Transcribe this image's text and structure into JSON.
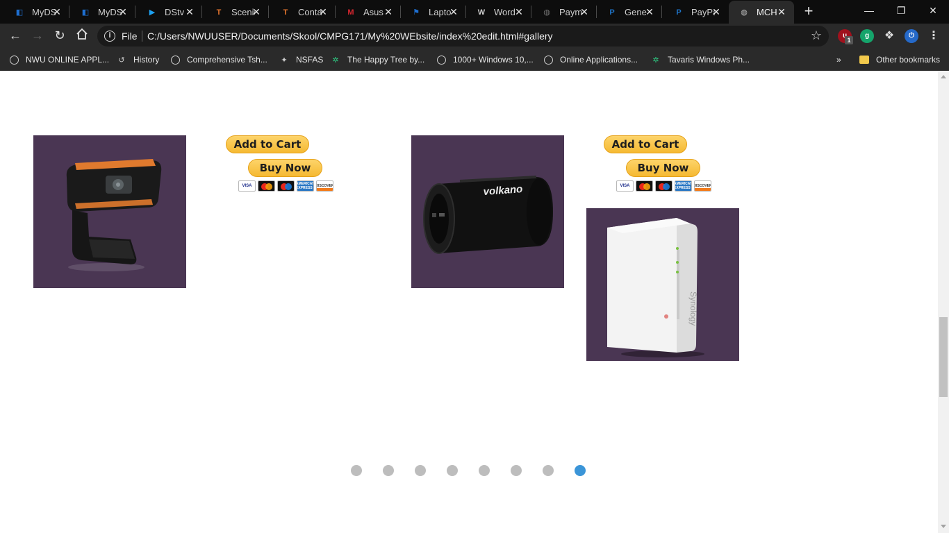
{
  "browser": {
    "tabs": [
      {
        "title": "MyDS",
        "icon": "mydsl-icon",
        "color": "#1e6fd1"
      },
      {
        "title": "MyDS",
        "icon": "mydsl-icon",
        "color": "#1e6fd1"
      },
      {
        "title": "DStv",
        "icon": "dstv-play-icon",
        "color": "#1da1f2"
      },
      {
        "title": "Scenic",
        "icon": "t-logo-icon",
        "color": "#e8772e"
      },
      {
        "title": "Conta",
        "icon": "t-logo-icon",
        "color": "#e8772e"
      },
      {
        "title": "Asus",
        "icon": "m-logo-icon",
        "color": "#d8262f"
      },
      {
        "title": "Lapto",
        "icon": "flag-icon",
        "color": "#1e6fd1"
      },
      {
        "title": "Word",
        "icon": "wordpress-icon",
        "color": "#cccccc"
      },
      {
        "title": "Paym",
        "icon": "globe-icon",
        "color": "#777777"
      },
      {
        "title": "Gene",
        "icon": "paypal-icon",
        "color": "#1f74c8"
      },
      {
        "title": "PayPa",
        "icon": "paypal-icon",
        "color": "#1f74c8"
      },
      {
        "title": "MCH",
        "icon": "globe-icon",
        "color": "#bbbbbb",
        "active": true
      }
    ],
    "new_tab": "+",
    "window": {
      "minimize": "—",
      "restore": "❐",
      "close": "✕"
    },
    "address": {
      "scheme_label": "File",
      "url": "C:/Users/NWUUSER/Documents/Skool/CMPG171/My%20WEbsite/index%20edit.html#gallery"
    },
    "extensions": [
      {
        "icon": "ublock-icon",
        "badge": "1",
        "color": "#a0111d"
      },
      {
        "icon": "grammarly-icon",
        "color": "#15a46b"
      },
      {
        "icon": "puzzle-icon",
        "color": "#2a2a2a"
      },
      {
        "icon": "power-icon",
        "color": "#2569c9"
      }
    ],
    "bookmarks": [
      {
        "label": "NWU ONLINE APPL...",
        "icon": "globe-icon"
      },
      {
        "label": "History",
        "icon": "history-icon"
      },
      {
        "label": "Comprehensive Tsh...",
        "icon": "globe-icon"
      },
      {
        "label": "NSFAS",
        "icon": "nsfas-icon"
      },
      {
        "label": "The Happy Tree by...",
        "icon": "tree-icon"
      },
      {
        "label": "1000+ Windows 10,...",
        "icon": "globe-icon"
      },
      {
        "label": "Online Applications...",
        "icon": "globe-icon"
      },
      {
        "label": "Tavaris Windows Ph...",
        "icon": "tree-icon"
      }
    ],
    "bookmarks_overflow": "»",
    "other_bookmarks": "Other bookmarks"
  },
  "gallery": {
    "products": [
      {
        "name": "webcam-image",
        "brand_text": ""
      },
      {
        "name": "speaker-image",
        "brand_text": "volkano"
      },
      {
        "name": "nas-image",
        "brand_text": "Synology"
      }
    ],
    "buttons": {
      "add_to_cart": "Add to Cart",
      "buy_now": "Buy Now"
    },
    "cards": [
      "VISA",
      "",
      "",
      "AMERICAN EXPRESS",
      "DISCOVER"
    ],
    "slides_total": 8,
    "active_slide": 8
  },
  "colors": {
    "product_bg": "#4a3653",
    "paypal_yellow": "#f5b932",
    "dot_inactive": "#bdbdbd",
    "dot_active": "#3b95d8"
  }
}
